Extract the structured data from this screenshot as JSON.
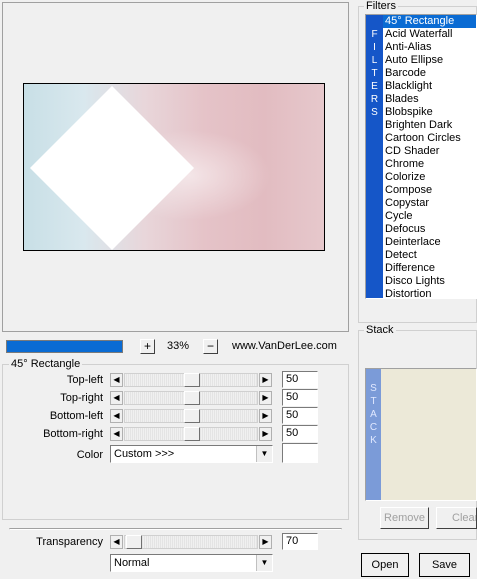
{
  "preview": {
    "image_desc": "preview-image"
  },
  "toolbar": {
    "plus": "+",
    "zoom": "33%",
    "minus": "−",
    "url": "www.VanDerLee.com",
    "progress": 1.0
  },
  "params_group": {
    "title": "45° Rectangle"
  },
  "params": [
    {
      "label": "Top-left",
      "value": "50"
    },
    {
      "label": "Top-right",
      "value": "50"
    },
    {
      "label": "Bottom-left",
      "value": "50"
    },
    {
      "label": "Bottom-right",
      "value": "50"
    }
  ],
  "color": {
    "label": "Color",
    "value": "Custom >>>"
  },
  "transparency": {
    "label": "Transparency",
    "value": "70"
  },
  "blend": {
    "value": "Normal"
  },
  "filters": {
    "title": "Filters",
    "band_letters": [
      "F",
      "I",
      "L",
      "T",
      "E",
      "R",
      "S"
    ],
    "items": [
      "45° Rectangle",
      "Acid Waterfall",
      "Anti-Alias",
      "Auto Ellipse",
      "Barcode",
      "Blacklight",
      "Blades",
      "Blobspike",
      "Brighten Dark",
      "Cartoon Circles",
      "CD Shader",
      "Chrome",
      "Colorize",
      "Compose",
      "Copystar",
      "Cycle",
      "Defocus",
      "Deinterlace",
      "Detect",
      "Difference",
      "Disco Lights",
      "Distortion"
    ],
    "selected": 0
  },
  "stack": {
    "title": "Stack",
    "band_letters": [
      "S",
      "T",
      "A",
      "C",
      "K"
    ],
    "remove": "Remove",
    "clear": "Clear"
  },
  "buttons": {
    "open": "Open",
    "save": "Save"
  },
  "colors": {
    "accent": "#0a6bd3",
    "band": "#1556c8",
    "stack_band": "#7b9bd8",
    "stack_bg": "#ece9d8"
  }
}
